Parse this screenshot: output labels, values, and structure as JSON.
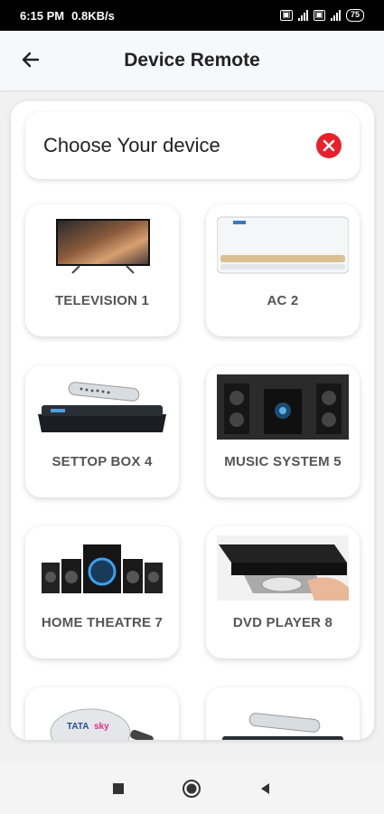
{
  "status_bar": {
    "time": "6:15 PM",
    "speed": "0.8KB/s",
    "battery": "75"
  },
  "app_bar": {
    "title": "Device Remote",
    "back_icon": "arrow-left-icon"
  },
  "search": {
    "placeholder": "Choose Your device",
    "clear_icon": "close-circle-icon",
    "clear_color": "#e8202a"
  },
  "devices": [
    {
      "label": "TELEVISION 1",
      "icon": "television-image"
    },
    {
      "label": "AC 2",
      "icon": "air-conditioner-image"
    },
    {
      "label": "SETTOP BOX 4",
      "icon": "settop-box-image"
    },
    {
      "label": "MUSIC SYSTEM 5",
      "icon": "music-system-image"
    },
    {
      "label": "HOME THEATRE 7",
      "icon": "home-theatre-image"
    },
    {
      "label": "DVD PLAYER 8",
      "icon": "dvd-player-image"
    },
    {
      "label": "",
      "icon": "dish-tv-image"
    },
    {
      "label": "",
      "icon": "settop-box-image"
    }
  ],
  "nav": {
    "recent_icon": "square-icon",
    "home_icon": "circle-icon",
    "back_icon": "triangle-back-icon"
  },
  "colors": {
    "accent_red": "#e8202a",
    "label_gray": "#555555"
  }
}
